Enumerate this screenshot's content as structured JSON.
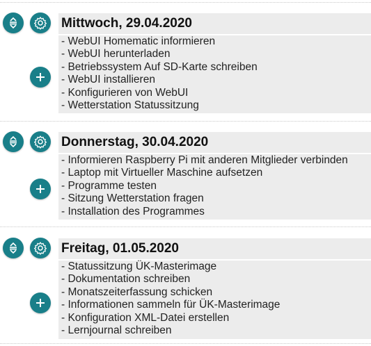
{
  "colors": {
    "accent": "#197f89",
    "panel": "#ececec"
  },
  "icons": {
    "reorder": "reorder-arrows-icon",
    "settings": "gear-icon",
    "add": "plus-icon"
  },
  "days": [
    {
      "title": "Mittwoch, 29.04.2020",
      "tasks": [
        "- WebUI Homematic informieren",
        "- WebUI herunterladen",
        "- Betriebssystem Auf SD-Karte schreiben",
        "- WebUI installieren",
        "- Konfigurieren von WebUI",
        "- Wetterstation Statussitzung"
      ]
    },
    {
      "title": "Donnerstag, 30.04.2020",
      "tasks": [
        "- Informieren Raspberry Pi mit anderen Mitglieder verbinden",
        "- Laptop mit Virtueller Maschine aufsetzen",
        "- Programme testen",
        "- Sitzung Wetterstation fragen",
        "- Installation des Programmes"
      ]
    },
    {
      "title": "Freitag, 01.05.2020",
      "tasks": [
        "- Statussitzung ÜK-Masterimage",
        "- Dokumentation schreiben",
        "- Monatszeiterfassung schicken",
        "- Informationen sammeln für ÜK-Masterimage",
        "- Konfiguration XML-Datei erstellen",
        "- Lernjournal schreiben"
      ]
    }
  ]
}
